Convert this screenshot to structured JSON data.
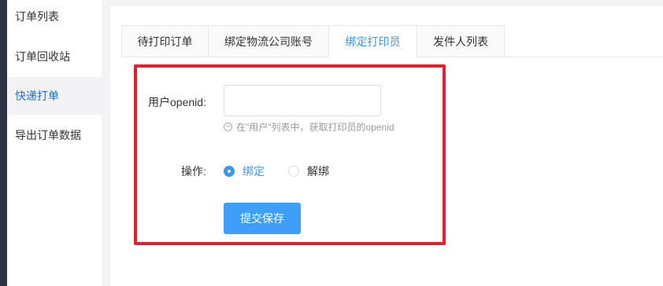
{
  "sidebar": {
    "items": [
      {
        "label": "订单列表"
      },
      {
        "label": "订单回收站"
      },
      {
        "label": "快递打单"
      },
      {
        "label": "导出订单数据"
      }
    ]
  },
  "tabs": [
    {
      "label": "待打印订单"
    },
    {
      "label": "绑定物流公司账号"
    },
    {
      "label": "绑定打印员"
    },
    {
      "label": "发件人列表"
    }
  ],
  "form": {
    "openid_label": "用户openid:",
    "openid_value": "",
    "openid_placeholder": "",
    "hint": "在\"用户\"列表中，获取打印员的openid",
    "operation_label": "操作:",
    "options": [
      {
        "label": "绑定"
      },
      {
        "label": "解绑"
      }
    ],
    "submit_label": "提交保存"
  },
  "colors": {
    "accent": "#3a96ee",
    "button": "#3f9ef8",
    "highlight_border": "#e0212b",
    "sidebar_dark": "#2b3544"
  }
}
